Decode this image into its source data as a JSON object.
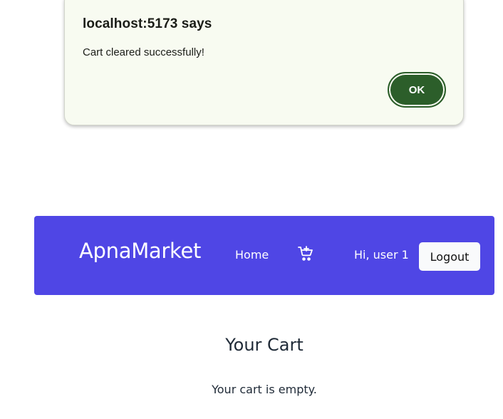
{
  "dialog": {
    "title": "localhost:5173 says",
    "message": "Cart cleared successfully!",
    "ok_label": "OK"
  },
  "navbar": {
    "brand": "ApnaMarket",
    "home_label": "Home",
    "cart_icon": "cart-plus-icon",
    "greeting": "Hi, user 1",
    "logout_label": "Logout",
    "background_color": "#4f46e5"
  },
  "cart": {
    "title": "Your Cart",
    "empty_message": "Your cart is empty."
  }
}
